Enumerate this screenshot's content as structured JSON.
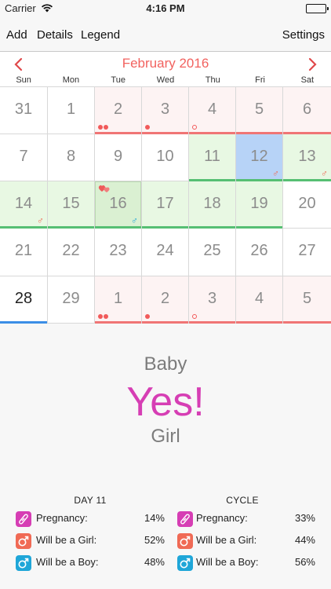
{
  "status_bar": {
    "carrier": "Carrier",
    "time": "4:16 PM"
  },
  "nav": {
    "add": "Add",
    "details": "Details",
    "legend": "Legend",
    "settings": "Settings"
  },
  "calendar": {
    "month_title": "February 2016",
    "weekdays": [
      "Sun",
      "Mon",
      "Tue",
      "Wed",
      "Thu",
      "Fri",
      "Sat"
    ],
    "rows": [
      [
        "31",
        "1",
        "2",
        "3",
        "4",
        "5",
        "6"
      ],
      [
        "7",
        "8",
        "9",
        "10",
        "11",
        "12",
        "13"
      ],
      [
        "14",
        "15",
        "16",
        "17",
        "18",
        "19",
        "20"
      ],
      [
        "21",
        "22",
        "23",
        "24",
        "25",
        "26",
        "27"
      ],
      [
        "28",
        "29",
        "1",
        "2",
        "3",
        "4",
        "5"
      ]
    ],
    "male_symbol": "♂"
  },
  "prediction": {
    "baby_label": "Baby",
    "answer": "Yes!",
    "gender": "Girl"
  },
  "stats": {
    "day": {
      "title": "DAY 11",
      "pregnancy_label": "Pregnancy:",
      "pregnancy_value": "14%",
      "girl_label": "Will be a Girl:",
      "girl_value": "52%",
      "boy_label": "Will be a Boy:",
      "boy_value": "48%"
    },
    "cycle": {
      "title": "CYCLE",
      "pregnancy_label": "Pregnancy:",
      "pregnancy_value": "33%",
      "girl_label": "Will be a Girl:",
      "girl_value": "44%",
      "boy_label": "Will be a Boy:",
      "boy_value": "56%"
    }
  },
  "colors": {
    "accent_red": "#f2625f",
    "pregnancy_icon": "#d63eb4",
    "girl_icon": "#f06a55",
    "boy_icon": "#1fa6d8",
    "answer": "#d63eb4"
  }
}
